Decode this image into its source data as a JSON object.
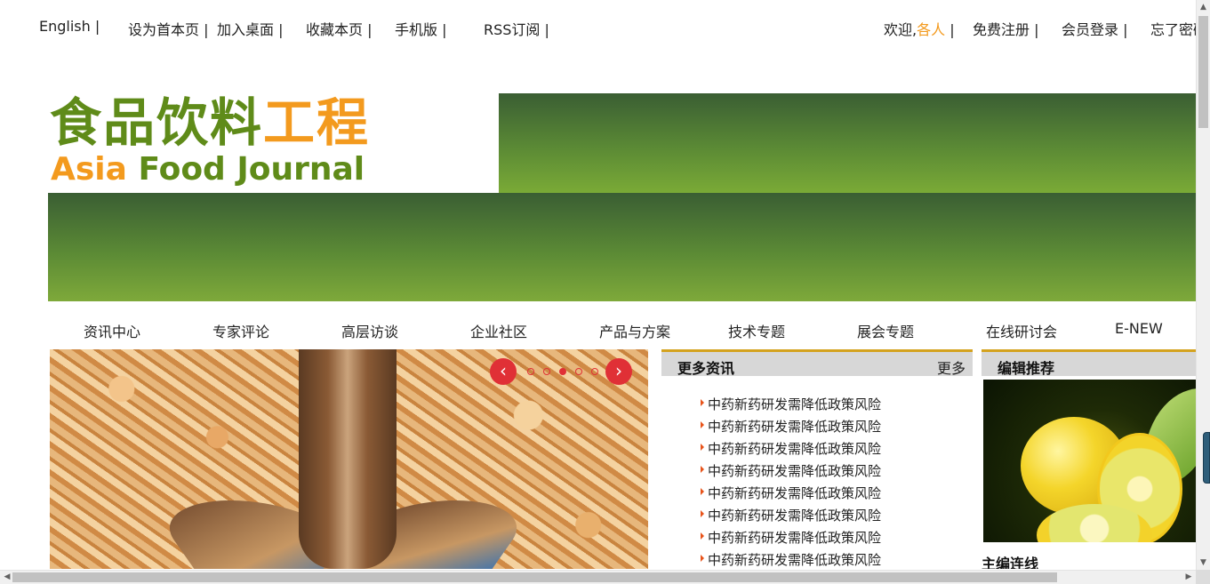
{
  "topbar": {
    "english": "English |",
    "set_homepage": "设为首本页 |",
    "add_desktop": "加入桌面 |",
    "bookmark": "收藏本页 |",
    "mobile": "手机版 |",
    "rss": "RSS订阅 |",
    "welcome": "欢迎,",
    "guest": "各人",
    "welcome_sep": " |",
    "register": "免费注册 |",
    "login": "会员登录 |",
    "forgot": "忘了密码"
  },
  "logo": {
    "cn_green": "食品饮料",
    "cn_orange": "工程",
    "en_orange": "Asia",
    "en_green": " Food Journal"
  },
  "nav": [
    "资讯中心",
    "专家评论",
    "高层访谈",
    "企业社区",
    "产品与方案",
    "技术专题",
    "展会专题",
    "在线研讨会",
    "E-NEW"
  ],
  "slider": {
    "prev_icon": "chevron-left-icon",
    "next_icon": "chevron-right-icon",
    "active_dot": 3,
    "dots": 5
  },
  "news": {
    "title": "更多资讯",
    "more": "更多",
    "items": [
      "中药新药研发需降低政策风险",
      "中药新药研发需降低政策风险",
      "中药新药研发需降低政策风险",
      "中药新药研发需降低政策风险",
      "中药新药研发需降低政策风险",
      "中药新药研发需降低政策风险",
      "中药新药研发需降低政策风险",
      "中药新药研发需降低政策风险"
    ]
  },
  "editor": {
    "title": "编辑推荐",
    "subtitle": "主编连线"
  },
  "colors": {
    "accent_orange": "#f39a1e",
    "brand_green": "#5f8b19",
    "slider_red": "#e03036",
    "panel_border": "#d4a21e"
  }
}
